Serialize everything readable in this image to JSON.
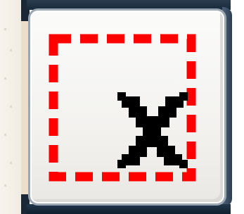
{
  "control": {
    "icon": "clear-selection-icon",
    "tooltip": ""
  },
  "colors": {
    "dashed_border": "#ff0000",
    "x_mark": "#000000",
    "button_face": "#f3f2ef",
    "frame": "#1c2b3b"
  }
}
